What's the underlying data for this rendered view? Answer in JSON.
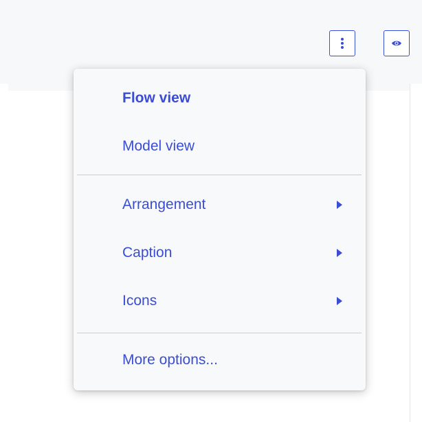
{
  "menu": {
    "items": [
      {
        "label": "Flow view"
      },
      {
        "label": "Model view"
      },
      {
        "label": "Arrangement"
      },
      {
        "label": "Caption"
      },
      {
        "label": "Icons"
      },
      {
        "label": "More options..."
      }
    ]
  },
  "toolbar": {
    "more_icon": "vertical-ellipsis-icon",
    "view_icon": "eye-icon"
  },
  "colors": {
    "accent": "#3a4dd3",
    "menu_bg": "#f8f9fb",
    "toolbar_bg": "#f7f8fa",
    "divider": "#c9ccd3"
  }
}
